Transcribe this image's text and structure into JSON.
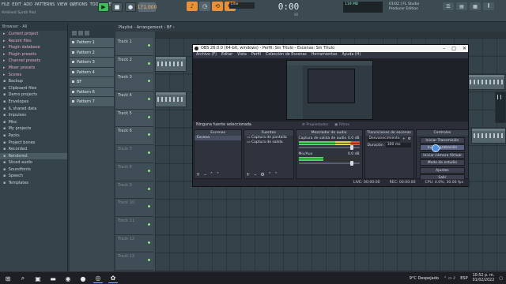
{
  "fl": {
    "menu": [
      "FILE",
      "EDIT",
      "ADD",
      "PATTERNS",
      "VIEW",
      "OPTIONS",
      "TOOLS",
      "HELP"
    ],
    "song_info": "Ambient Synth Pad",
    "pattern_mode": "PAT",
    "tempo": "171.000",
    "line_mode": "Line",
    "time": "0:00",
    "time_sub": "00",
    "cpu": "119 MB",
    "plugin_news": [
      "01/02 | FL Studio",
      "Producer Edition"
    ],
    "playlist_title": "Playlist - Arrangement › BF ›"
  },
  "browser": {
    "header": "Browser - All",
    "items": [
      {
        "label": "Current project",
        "pink": true
      },
      {
        "label": "Recent files",
        "pink": true
      },
      {
        "label": "Plugin database",
        "pink": true
      },
      {
        "label": "Plugin presets",
        "pink": true
      },
      {
        "label": "Channel presets",
        "pink": true
      },
      {
        "label": "Mixer presets",
        "pink": true
      },
      {
        "label": "Scores",
        "pink": true
      },
      {
        "label": "Backup",
        "pink": false
      },
      {
        "label": "Clipboard files",
        "pink": false
      },
      {
        "label": "Demo projects",
        "pink": false
      },
      {
        "label": "Envelopes",
        "pink": false
      },
      {
        "label": "IL shared data",
        "pink": false
      },
      {
        "label": "Impulses",
        "pink": false
      },
      {
        "label": "Misc",
        "pink": false
      },
      {
        "label": "My projects",
        "pink": false
      },
      {
        "label": "Packs",
        "pink": false
      },
      {
        "label": "Project bones",
        "pink": false
      },
      {
        "label": "Recorded",
        "pink": false
      },
      {
        "label": "Rendered",
        "pink": false,
        "active": true
      },
      {
        "label": "Sliced audio",
        "pink": false
      },
      {
        "label": "Soundfonts",
        "pink": false
      },
      {
        "label": "Speech",
        "pink": false
      },
      {
        "label": "Templates",
        "pink": false
      }
    ]
  },
  "patterns": [
    "Pattern 1",
    "Pattern 2",
    "Pattern 3",
    "Pattern 4",
    "BF",
    "Pattern 6",
    "Pattern 7"
  ],
  "tracks": [
    "Track 1",
    "Track 2",
    "Track 3",
    "Track 4",
    "Track 5",
    "Track 6",
    "Track 7",
    "Track 8",
    "Track 9",
    "Track 10",
    "Track 11",
    "Track 12",
    "Track 13"
  ],
  "obs": {
    "title": "OBS 26.0.0 (64-bit, windows) - Perfil: Sin Título - Escenas: Sin Título",
    "menu": [
      "Archivo (F)",
      "Editar",
      "Vista",
      "Perfil",
      "Colección de Escenas",
      "Herramientas",
      "Ayuda (H)"
    ],
    "no_source": "Ninguna fuente seleccionada",
    "properties": "Propiedades",
    "filters": "Filtros",
    "docks": {
      "scenes": {
        "title": "Escenas",
        "items": [
          "Escena"
        ]
      },
      "sources": {
        "title": "Fuentes",
        "items": [
          "Captura de pantalla",
          "Captura de salida"
        ]
      },
      "mixer": {
        "title": "Mezclador de audio",
        "channels": [
          {
            "name": "Captura de salida de audio",
            "db": "0.0 dB"
          },
          {
            "name": "Mic/Aux",
            "db": "0.0 dB"
          }
        ]
      },
      "transitions": {
        "title": "Transiciones de escenas",
        "type": "Desvanecimiento",
        "duration_label": "Duración",
        "duration": "300 ms"
      },
      "controls": {
        "title": "Controles",
        "buttons": [
          "Iniciar Transmisión",
          "Iniciar grabación",
          "Iniciar cámara Virtual",
          "Modo de estudio",
          "Ajustes",
          "Salir"
        ]
      }
    },
    "status": {
      "live": "LIVE: 00:00:00",
      "rec": "REC: 00:00:00",
      "cpu": "CPU: 4.0%, 30.00 fps"
    }
  },
  "taskbar": {
    "weather": "9°C  Despejado",
    "lang": "ESP",
    "time": "10:52 p. m.",
    "date": "01/02/2022"
  }
}
